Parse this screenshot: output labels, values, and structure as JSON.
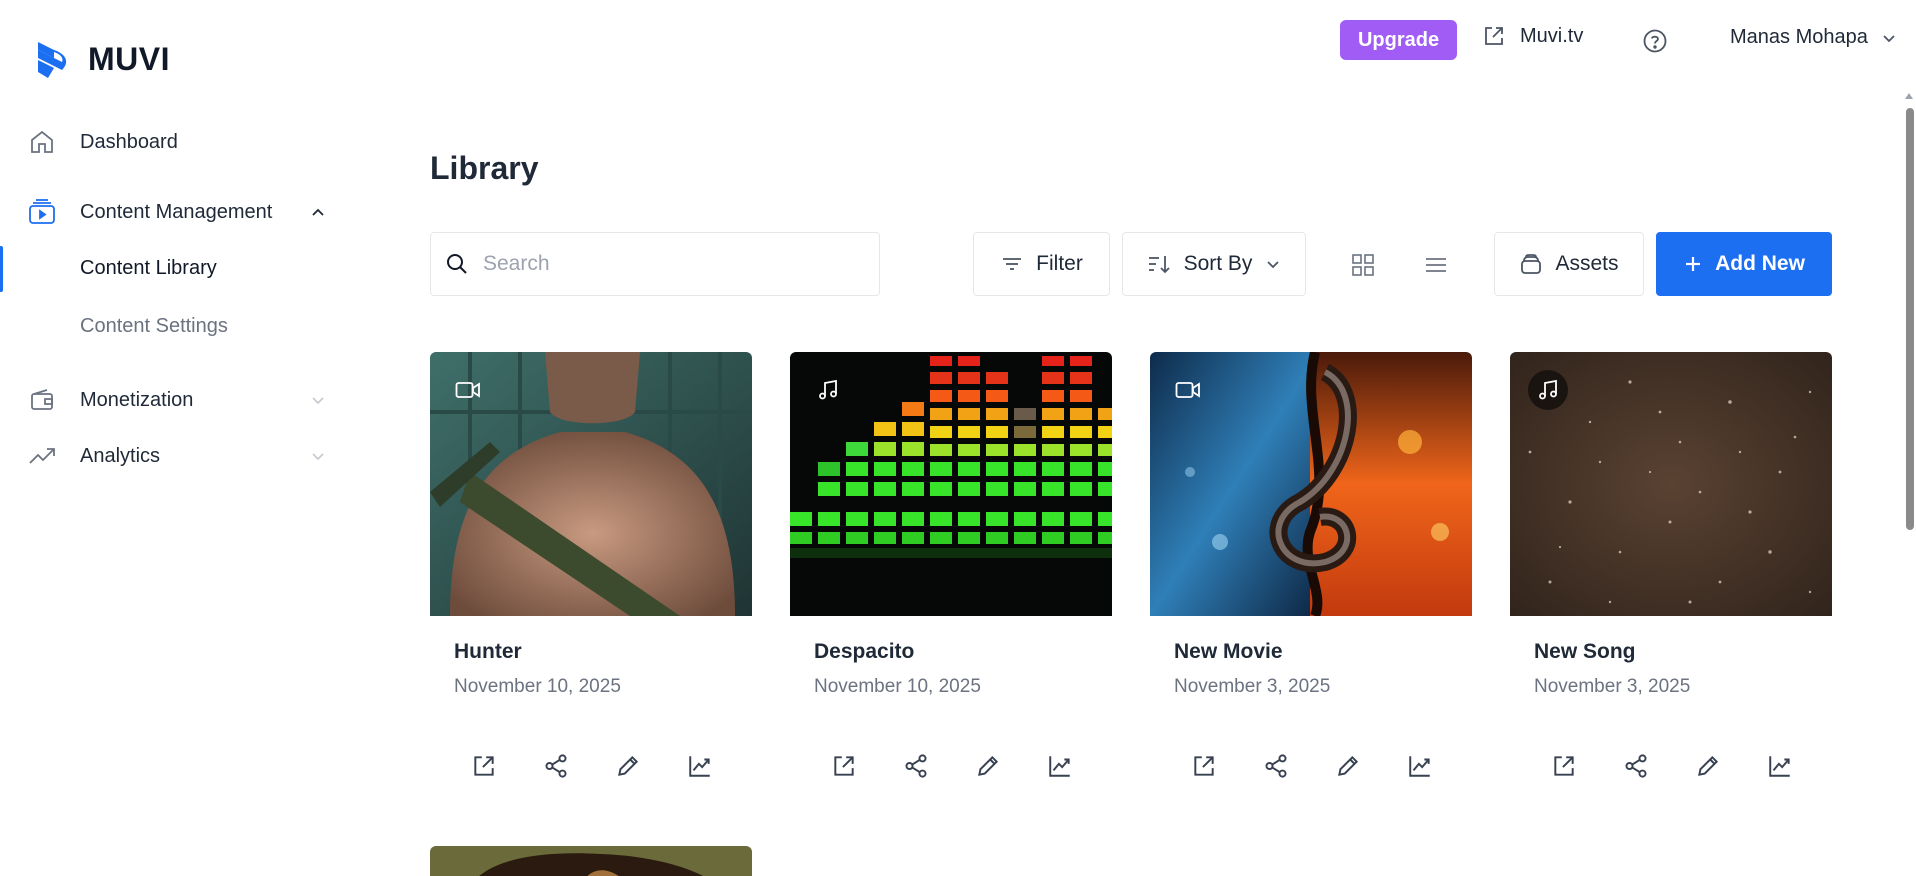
{
  "brand": {
    "name": "MUVI"
  },
  "header": {
    "upgrade_label": "Upgrade",
    "site_link_label": "Muvi.tv",
    "user_name": "Manas Mohapa"
  },
  "sidebar": {
    "items": [
      {
        "label": "Dashboard",
        "icon": "home-icon"
      },
      {
        "label": "Content Management",
        "icon": "content-icon",
        "expanded": true,
        "children": [
          {
            "label": "Content Library",
            "active": true
          },
          {
            "label": "Content Settings",
            "active": false
          }
        ]
      },
      {
        "label": "Monetization",
        "icon": "wallet-icon",
        "expanded": false
      },
      {
        "label": "Analytics",
        "icon": "trend-icon",
        "expanded": false
      }
    ]
  },
  "main": {
    "title": "Library",
    "search_placeholder": "Search",
    "filter_label": "Filter",
    "sort_label": "Sort By",
    "assets_label": "Assets",
    "add_label": "Add New"
  },
  "cards": [
    {
      "title": "Hunter",
      "date": "November 10, 2025",
      "type": "video"
    },
    {
      "title": "Despacito",
      "date": "November 10, 2025",
      "type": "audio"
    },
    {
      "title": "New Movie",
      "date": "November 3, 2025",
      "type": "video"
    },
    {
      "title": "New Song",
      "date": "November 3, 2025",
      "type": "audio"
    }
  ],
  "colors": {
    "accent": "#1d6ff2",
    "upgrade": "#a05cf5",
    "text": "#1f2937",
    "muted": "#6b7280"
  }
}
